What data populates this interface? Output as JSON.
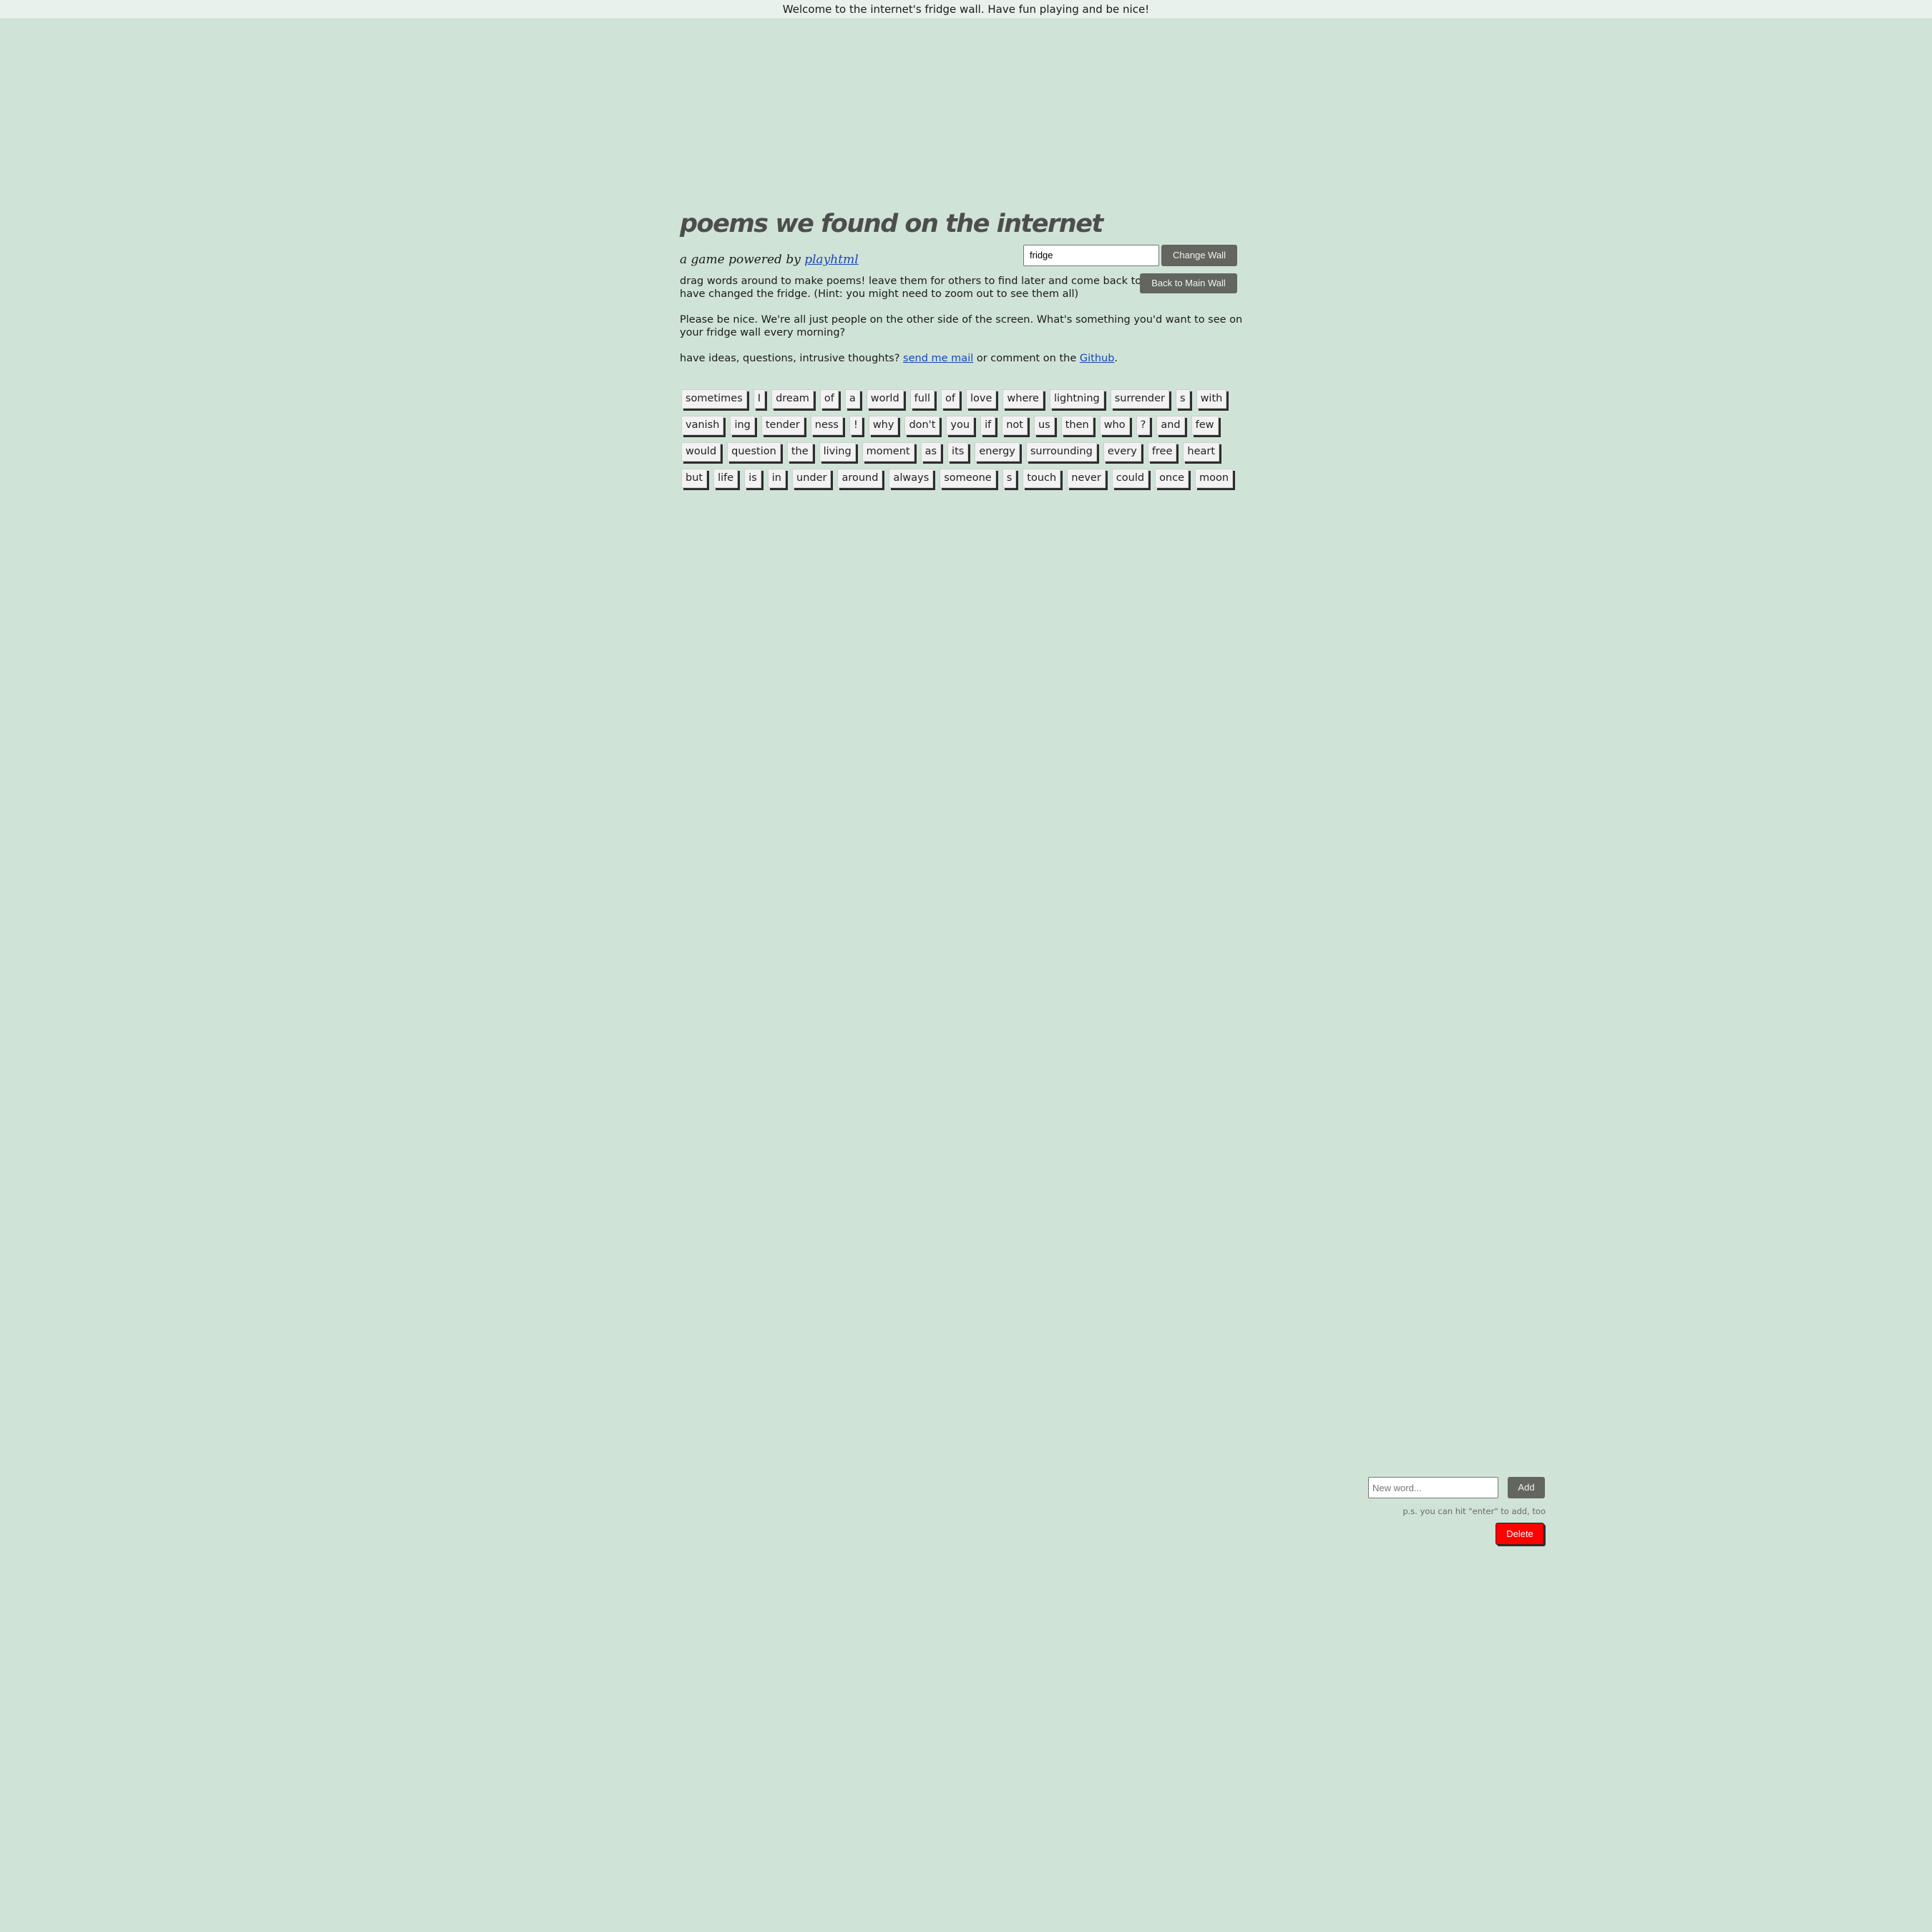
{
  "banner": {
    "text": "Welcome to the internet's fridge wall. Have fun playing and be nice!"
  },
  "header": {
    "title": "poems we found on the internet",
    "subtitle_prefix": "a game powered by ",
    "subtitle_link": "playhtml"
  },
  "intro": {
    "p1": "drag words around to make poems! leave them for others to find later and come back to see how people have changed the fridge. (Hint: you might need to zoom out to see them all)",
    "p2": "Please be nice. We're all just people on the other side of the screen. What's something you'd want to see on your fridge wall every morning?",
    "p3_prefix": "have ideas, questions, intrusive thoughts? ",
    "p3_link1": "send me mail",
    "p3_middle": " or comment on the ",
    "p3_link2": "Github",
    "p3_suffix": "."
  },
  "wall_form": {
    "input_value": "fridge",
    "change_label": "Change Wall",
    "back_label": "Back to Main Wall"
  },
  "magnets": {
    "rows": [
      [
        "sometimes",
        "I",
        "dream",
        "of",
        "a",
        "world",
        "full",
        "of",
        "love",
        "where",
        "lightning",
        "surrender",
        "s",
        "with"
      ],
      [
        "vanish",
        "ing",
        "tender",
        "ness",
        "!",
        "why",
        "don't",
        "you",
        "if",
        "not",
        "us",
        "then",
        "who",
        "?",
        "and",
        "few"
      ],
      [
        "would",
        "question",
        "the",
        "living",
        "moment",
        "as",
        "its",
        "energy",
        "surrounding",
        "every",
        "free",
        "heart"
      ],
      [
        "but",
        "life",
        "is",
        "in",
        "under",
        "around",
        "always",
        "someone",
        "s",
        "touch",
        "never",
        "could",
        "once",
        "moon"
      ]
    ]
  },
  "add_word": {
    "placeholder": "New word...",
    "add_label": "Add",
    "hint": "p.s. you can hit \"enter\" to add, too",
    "delete_label": "Delete"
  },
  "colors": {
    "background": "#d0e3d7",
    "button_dark": "#62665f",
    "delete": "#ff0000",
    "link": "#1a46b8"
  }
}
